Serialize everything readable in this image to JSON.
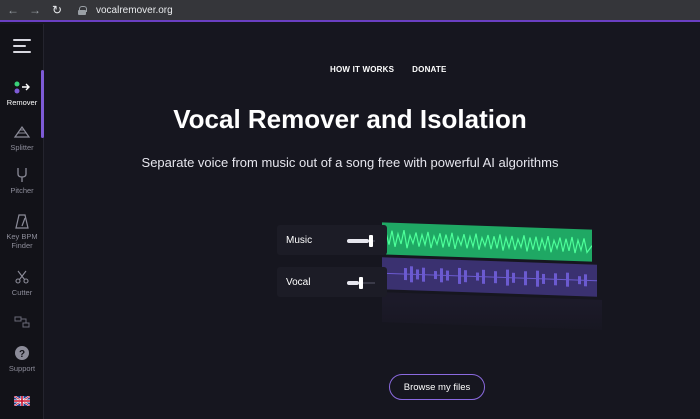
{
  "browser": {
    "url": "vocalremover.org",
    "back_icon": "arrow-left-icon",
    "forward_icon": "arrow-right-icon",
    "reload_icon": "reload-icon"
  },
  "sidebar": {
    "items": [
      {
        "label": "Remover",
        "icon": "remover-icon",
        "active": true
      },
      {
        "label": "Splitter",
        "icon": "splitter-icon",
        "active": false
      },
      {
        "label": "Pitcher",
        "icon": "tuning-fork-icon",
        "active": false
      },
      {
        "label": "Key BPM Finder",
        "icon": "metronome-icon",
        "active": false
      },
      {
        "label": "Cutter",
        "icon": "scissors-icon",
        "active": false
      },
      {
        "label": "",
        "icon": "joiner-icon",
        "active": false
      },
      {
        "label": "Support",
        "icon": "question-icon",
        "active": false
      },
      {
        "label": "",
        "icon": "uk-flag-icon",
        "active": false
      }
    ],
    "accent": "#7e5bd6"
  },
  "nav": {
    "how_it_works": "HOW IT WORKS",
    "donate": "DONATE"
  },
  "hero": {
    "title": "Vocal Remover and Isolation",
    "subtitle": "Separate voice from music out of a song free with powerful AI algorithms"
  },
  "tracks": [
    {
      "name": "Music",
      "color": "#1fa864"
    },
    {
      "name": "Vocal",
      "color": "#5b4bb0"
    }
  ],
  "browse_label": "Browse my files",
  "colors": {
    "background": "#16161f",
    "accent": "#8b6ae0",
    "music_wave": "#2ee57c",
    "vocal_wave": "#6b5ad0"
  }
}
